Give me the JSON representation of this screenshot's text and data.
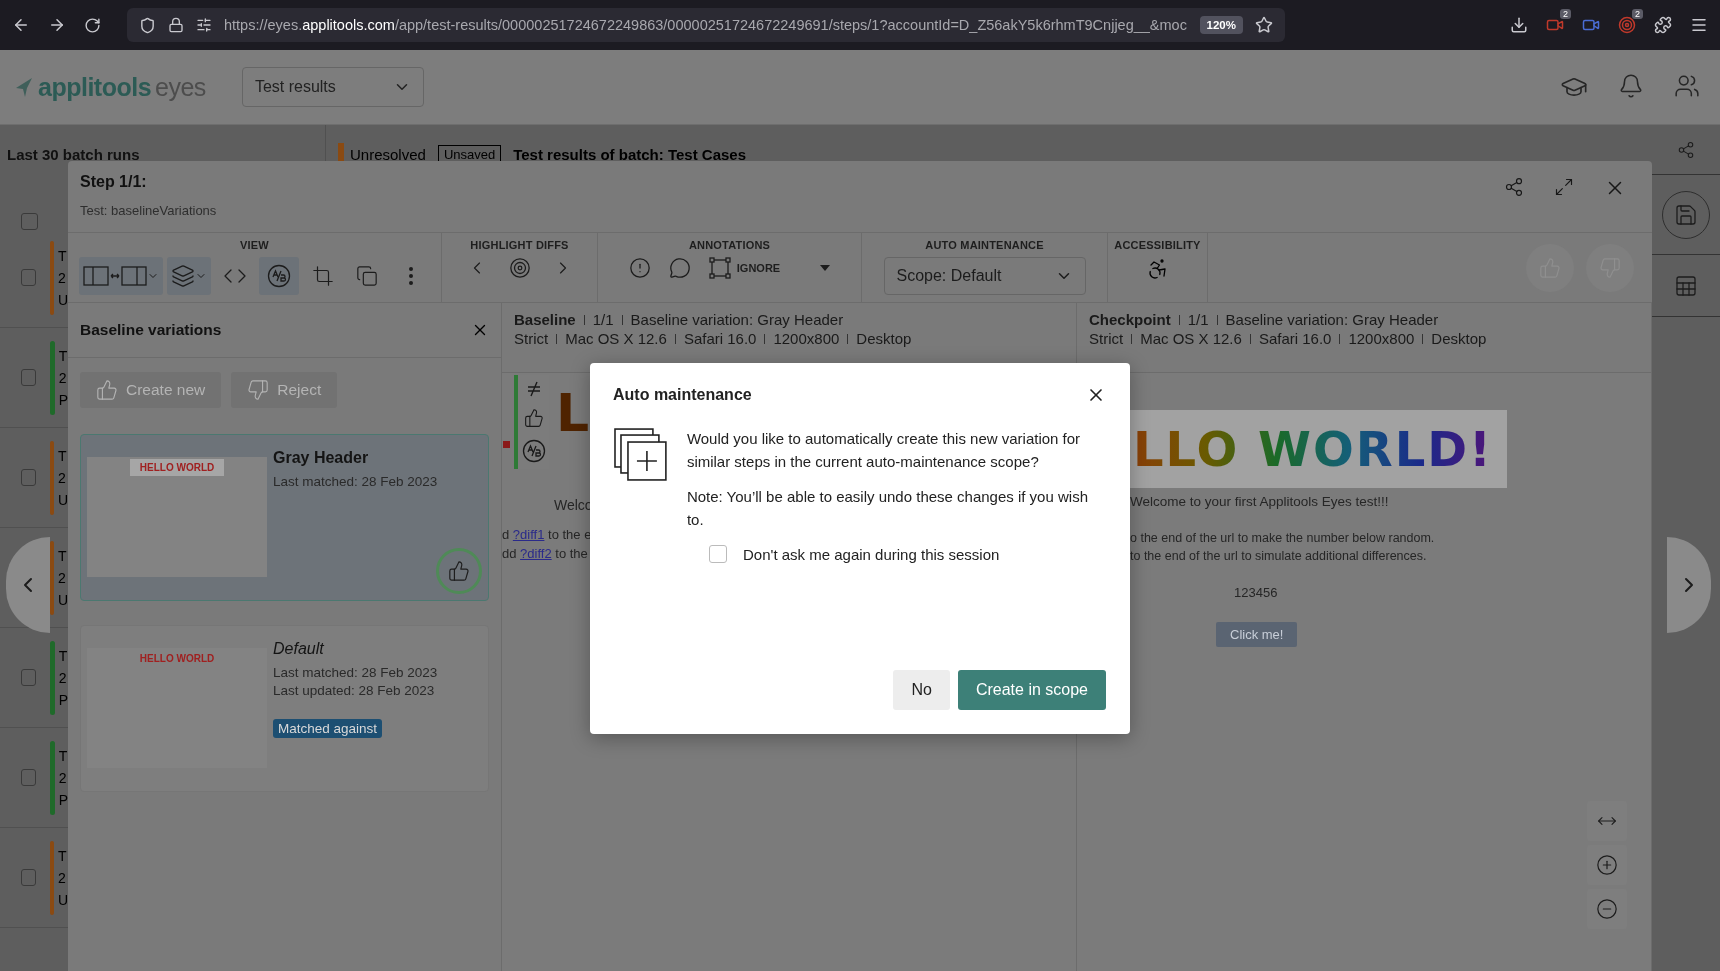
{
  "browser": {
    "url_prefix": "https://eyes.",
    "url_domain": "applitools.com",
    "url_path": "/app/test-results/00000251724672249863/00000251724672249691/steps/1?accountId=D_Z56akY5k6rhmT9Cnjjeg__&moc",
    "zoom": "120%",
    "extension_badges": [
      "2",
      "2"
    ]
  },
  "app": {
    "logo": "applitools",
    "logo_suffix": "eyes",
    "dropdown": "Test results"
  },
  "background": {
    "title": "Last 30 batch runs",
    "status": "Unresolved",
    "tag": "Unsaved",
    "batch_title": "Test results of batch:  Test Cases",
    "select_all_checked": false,
    "rows": [
      {
        "color": "#8a4a12",
        "checked": false,
        "lines": [
          "T",
          "2",
          "U"
        ]
      },
      {
        "color": "#1f6a2a",
        "checked": false,
        "lines": [
          "T",
          "2",
          "P"
        ]
      },
      {
        "color": "#8a4a12",
        "checked": false,
        "lines": [
          "T",
          "2",
          "U"
        ]
      },
      {
        "color": "#8a4a12",
        "lines": [
          "T",
          "2",
          "U"
        ]
      },
      {
        "color": "#1f6a2a",
        "checked": false,
        "lines": [
          "T",
          "2",
          "P"
        ]
      },
      {
        "color": "#1f6a2a",
        "checked": false,
        "lines": [
          "T",
          "2",
          "P"
        ]
      },
      {
        "color": "#8a4a12",
        "checked": false,
        "lines": [
          "T",
          "2",
          "U"
        ]
      }
    ]
  },
  "step": {
    "title": "Step 1/1:",
    "test": "Test: baselineVariations"
  },
  "toolbar": {
    "view_label": "VIEW",
    "view_tools": [
      {
        "kind": "split",
        "selected": true
      },
      {
        "kind": "layers",
        "selected": true
      },
      {
        "kind": "code",
        "selected": false
      },
      {
        "kind": "ab",
        "selected": true
      },
      {
        "kind": "crop",
        "selected": false
      },
      {
        "kind": "overlap",
        "selected": false
      },
      {
        "kind": "more",
        "selected": false
      }
    ],
    "highlight_label": "HIGHLIGHT DIFFS",
    "annotations_label": "ANNOTATIONS",
    "ignore_label": "IGNORE",
    "auto_label": "AUTO MAINTENANCE",
    "scope": "Scope: Default",
    "accessibility_label": "ACCESSIBILITY"
  },
  "variations": {
    "title": "Baseline variations",
    "actions": [
      "Create new",
      "Reject"
    ],
    "items": [
      {
        "kind": "named",
        "name": "Gray Header",
        "lines": [
          "Last matched: 28 Feb 2023"
        ],
        "selected": true,
        "thumb_title": "HELLO WORLD",
        "header_gray": true
      },
      {
        "kind": "default",
        "name": "Default",
        "lines": [
          "Last matched: 28 Feb 2023",
          "Last updated: 28 Feb 2023"
        ],
        "selected": false,
        "thumb_title": "HELLO WORLD",
        "header_gray": false,
        "badge": "Matched against"
      }
    ]
  },
  "baseline": {
    "title": "Baseline",
    "meta1": [
      "1/1",
      "Baseline variation: Gray Header"
    ],
    "meta2": [
      "Strict",
      "Mac OS X 12.6",
      "Safari 16.0",
      "1200x800",
      "Desktop"
    ],
    "shot": {
      "heading": "L",
      "welcome": "Welco",
      "links": [
        {
          "pre": "d ",
          "link": "?diff1",
          "post": " to the e"
        },
        {
          "pre": "dd ",
          "link": "?diff2",
          "post": " to the"
        }
      ]
    }
  },
  "checkpoint": {
    "title": "Checkpoint",
    "meta1": [
      "1/1",
      "Baseline variation: Gray Header"
    ],
    "meta2": [
      "Strict",
      "Mac OS X 12.6",
      "Safari 16.0",
      "1200x800",
      "Desktop"
    ],
    "shot": {
      "heading": "LLO WORLD!",
      "welcome": "Welcome to your first Applitools Eyes test!!!",
      "lines": [
        "o the end of the url to make the number below random.",
        "to the end of the url to simulate additional differences."
      ],
      "number": "123456",
      "button": "Click me!"
    }
  },
  "dialog": {
    "title": "Auto maintenance",
    "question": "Would you like to automatically create this new variation for similar steps in the current auto-maintenance scope?",
    "note": "Note: You’ll be able to easily undo these changes if you wish to.",
    "checkbox": {
      "label": "Don't ask me again during this session",
      "checked": false
    },
    "buttons": [
      {
        "kind": "secondary",
        "label": "No"
      },
      {
        "kind": "primary",
        "label": "Create in scope"
      }
    ]
  }
}
